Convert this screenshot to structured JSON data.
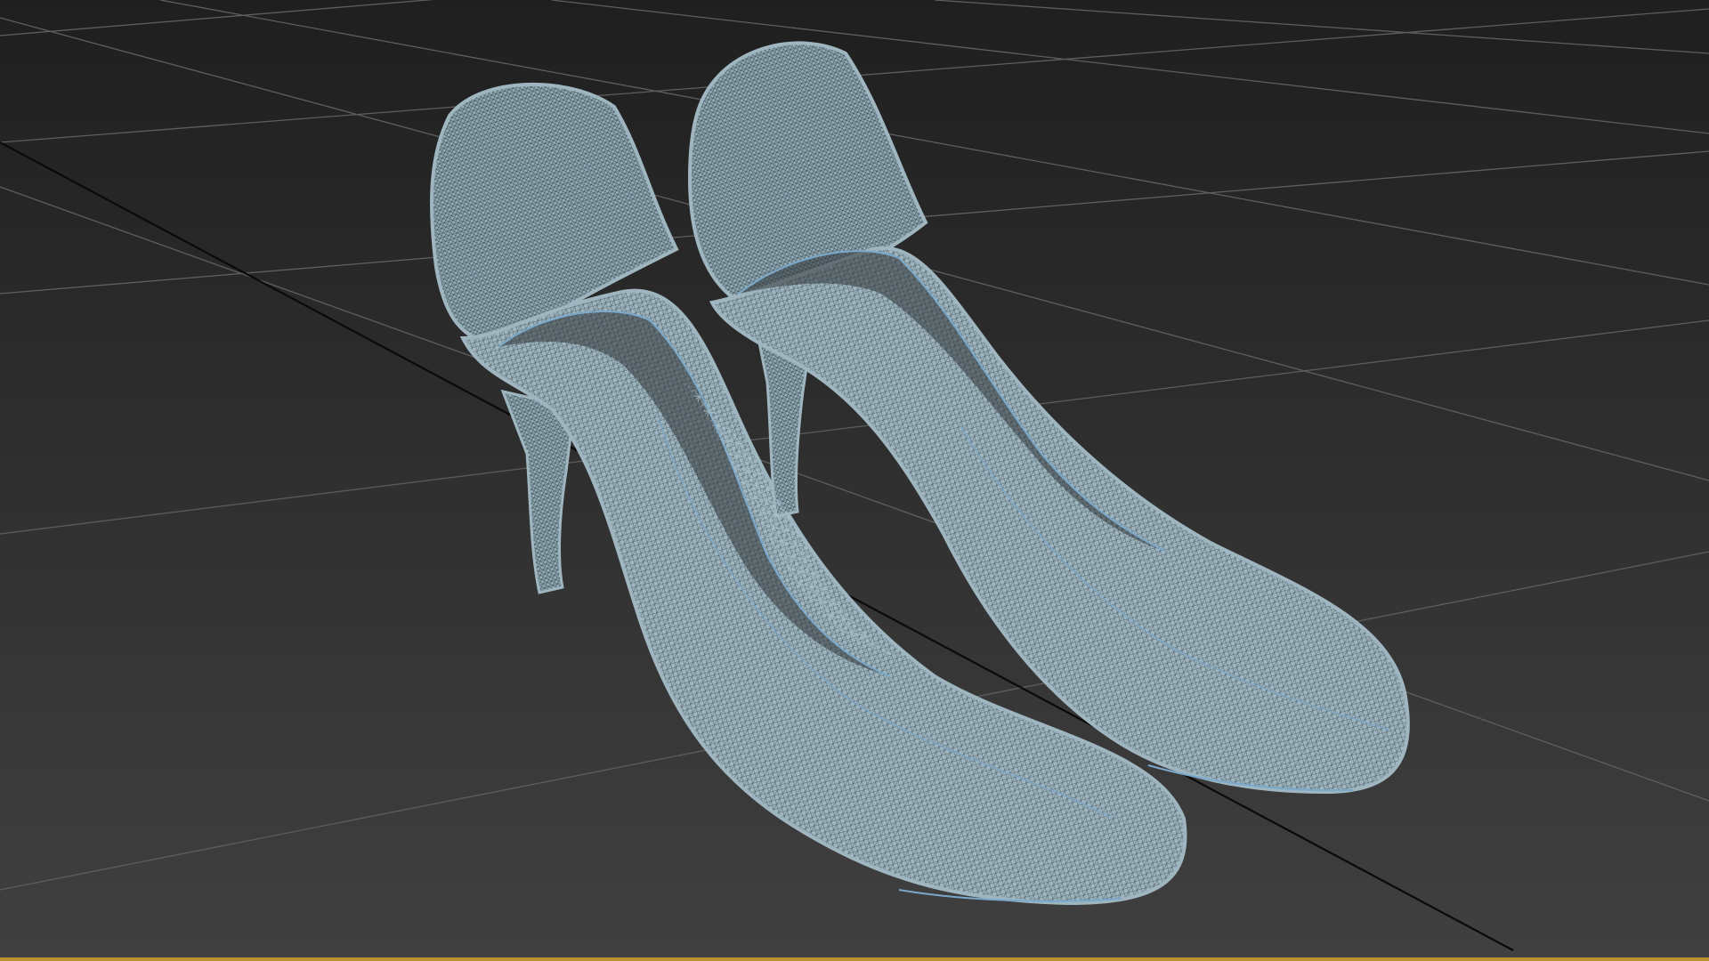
{
  "viewport": {
    "view_mode": "perspective",
    "render_style": "wireframe",
    "scene_object": "pair-of-high-heel-pumps",
    "colors": {
      "background_top": "#1f1f1f",
      "background_bottom": "#404040",
      "grid_line": "#5e5e5e",
      "axis_line": "#0a0a0a",
      "mesh_fill": "#9fb6c0",
      "mesh_wire": "#3a4a52",
      "mesh_edge": "#7aa9cc",
      "active_border": "#b8922c"
    }
  }
}
